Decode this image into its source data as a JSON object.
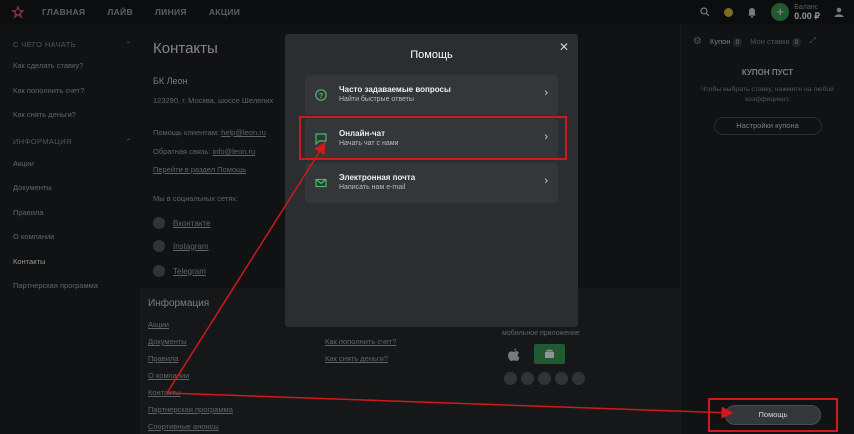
{
  "header": {
    "nav": [
      "ГЛАВНАЯ",
      "ЛАЙВ",
      "ЛИНИЯ",
      "АКЦИИ"
    ],
    "balance_label": "Баланс",
    "balance_value": "0.00 ₽"
  },
  "sidebar": {
    "section1": "С ЧЕГО НАЧАТЬ",
    "section1_items": [
      "Как сделать ставку?",
      "Как пополнить счет?",
      "Как снять деньги?"
    ],
    "section2": "ИНФОРМАЦИЯ",
    "section2_items": [
      "Акции",
      "Документы",
      "Правила",
      "О компании",
      "Контакты",
      "Партнерская программа"
    ]
  },
  "page": {
    "title": "Контакты",
    "company": "БК Леон",
    "address": "123290, г. Москва, шоссе Шелепих",
    "help_label": "Помощь клиентам:",
    "help_email": "help@leon.ru",
    "feedback_label": "Обратная связь:",
    "feedback_email": "info@leon.ru",
    "help_link": "Перейти в раздел Помощь",
    "social_title": "Мы в социальных сетях:",
    "social": [
      "Вконтакте",
      "Instagram",
      "Telegram"
    ]
  },
  "footer": {
    "title": "Информация",
    "links": [
      "Акции",
      "Документы",
      "Правила",
      "О компании",
      "Контакты",
      "Партнерская программа",
      "Спортивные анонсы"
    ],
    "middle_links": [
      "Как пополнить счет?",
      "Как снять деньги?"
    ],
    "app_text": "мобильное приложение"
  },
  "coupon": {
    "tab1": "Купон",
    "tab1_count": "0",
    "tab2": "Мои ставки",
    "tab2_count": "0",
    "empty_title": "КУПОН ПУСТ",
    "empty_text": "Чтобы выбрать ставку, нажмите на любой коэффициент.",
    "settings_button": "Настройки купона"
  },
  "help_modal": {
    "title": "Помощь",
    "items": [
      {
        "title": "Часто задаваемые вопросы",
        "subtitle": "Найти быстрые ответы"
      },
      {
        "title": "Онлайн-чат",
        "subtitle": "Начать чат с нами"
      },
      {
        "title": "Электронная почта",
        "subtitle": "Написать нам e-mail"
      }
    ]
  },
  "help_button": "Помощь",
  "colors": {
    "accent_green": "#3a9a54",
    "highlight_red": "#d0191b",
    "icon_green": "#3fbf6a"
  }
}
